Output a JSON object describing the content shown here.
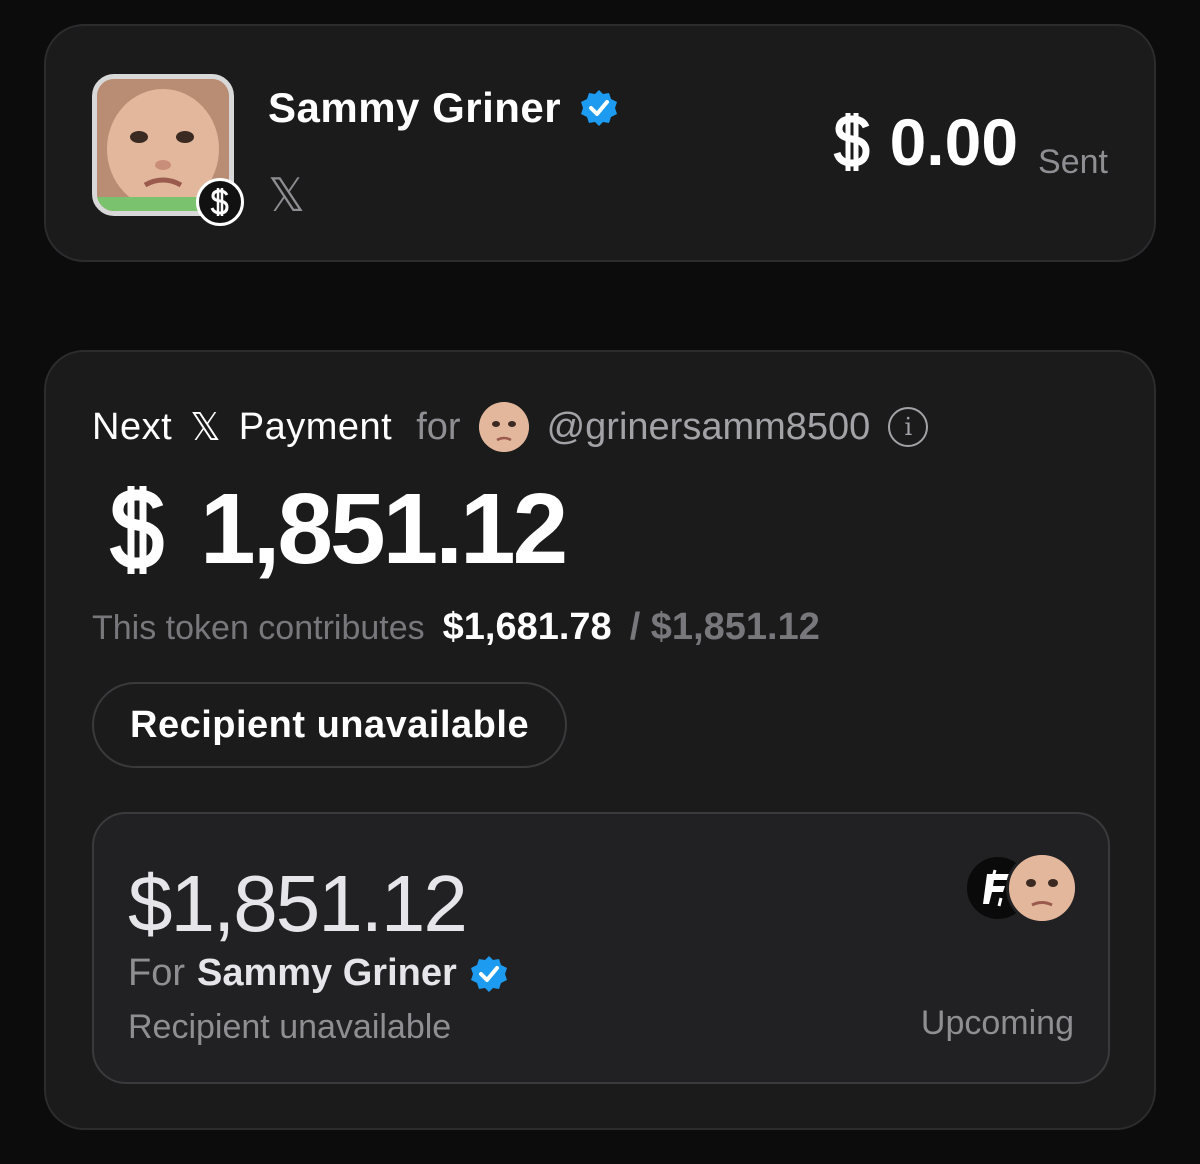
{
  "profile": {
    "name": "Sammy Griner",
    "platform_icon": "x-logo-icon",
    "platform_glyph": "𝕏",
    "sent_amount": "0.00",
    "sent_label": "Sent"
  },
  "payment": {
    "title_prefix": "Next",
    "title_x": "𝕏",
    "title_suffix": "Payment",
    "for_label": "for",
    "handle": "@grinersamm8500",
    "info_glyph": "i",
    "amount": "1,851.12",
    "contrib_label": "This token contributes",
    "contrib_value": "$1,681.78",
    "contrib_total": "/ $1,851.12",
    "status_pill": "Recipient unavailable"
  },
  "upcoming_card": {
    "amount": "$1,851.12",
    "for_label": "For",
    "recipient_name": "Sammy Griner",
    "status": "Recipient unavailable",
    "state": "Upcoming"
  },
  "colors": {
    "background": "#0c0c0d",
    "card": "#1b1b1c",
    "verified_blue": "#1d9bf0",
    "muted_text": "#8e8e93"
  }
}
